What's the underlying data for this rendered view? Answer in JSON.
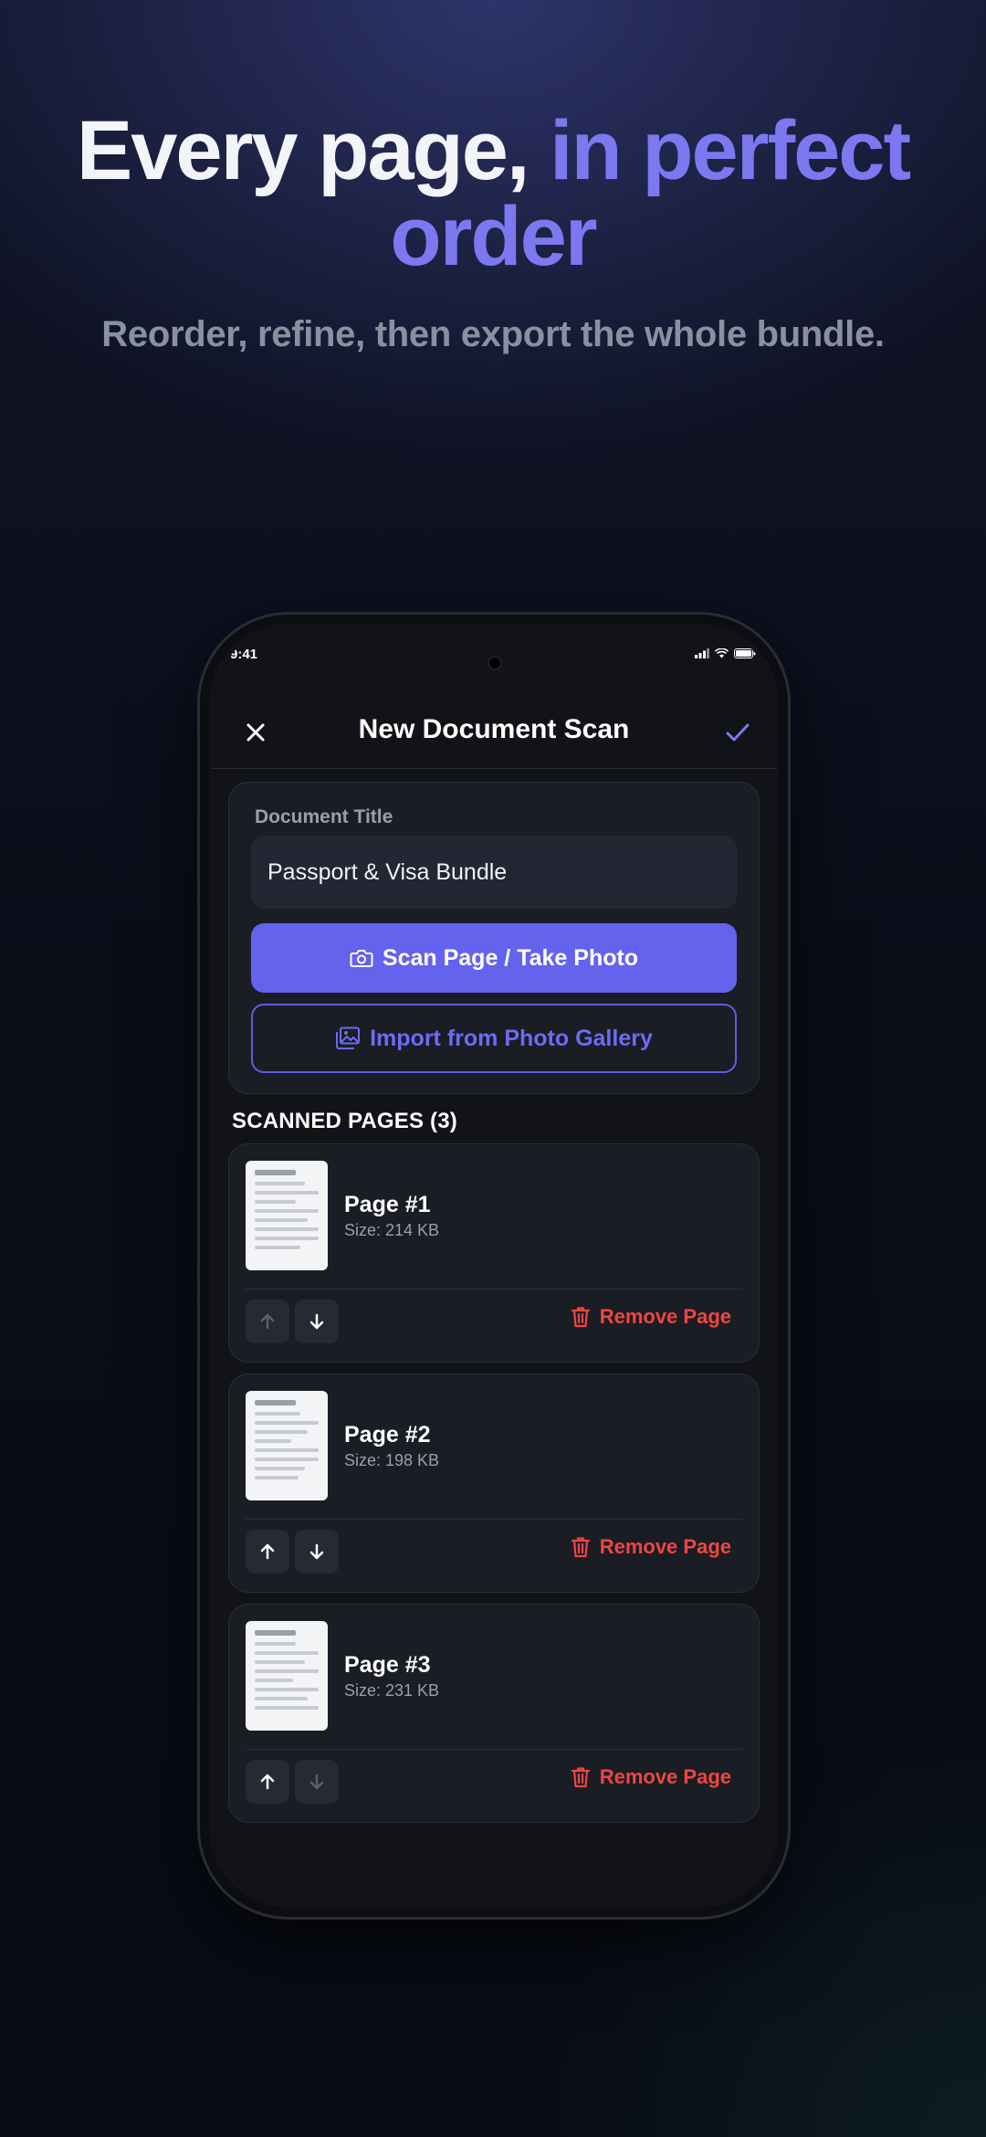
{
  "hero": {
    "headline_part1": "Every page, ",
    "headline_accent": "in perfect order",
    "subheadline": "Reorder, refine, then export the whole bundle."
  },
  "status_bar": {
    "time": "9:41"
  },
  "nav": {
    "close_icon": "close-icon",
    "title": "New Document Scan",
    "confirm_icon": "checkmark-icon"
  },
  "document": {
    "title_label": "Document Title",
    "title_value": "Passport & Visa Bundle",
    "scan_button": "Scan Page / Take Photo",
    "import_button": "Import from Photo Gallery"
  },
  "pages_section": {
    "heading": "SCANNED PAGES (3)",
    "remove_label": "Remove Page",
    "pages": [
      {
        "title": "Page #1",
        "size": "Size: 214 KB",
        "up_enabled": false,
        "down_enabled": true
      },
      {
        "title": "Page #2",
        "size": "Size: 198 KB",
        "up_enabled": true,
        "down_enabled": true
      },
      {
        "title": "Page #3",
        "size": "Size: 231 KB",
        "up_enabled": true,
        "down_enabled": false
      }
    ]
  },
  "colors": {
    "accent": "#7c78f0",
    "primary_button": "#6463ee",
    "danger": "#f04542",
    "card": "#1a1d24"
  }
}
